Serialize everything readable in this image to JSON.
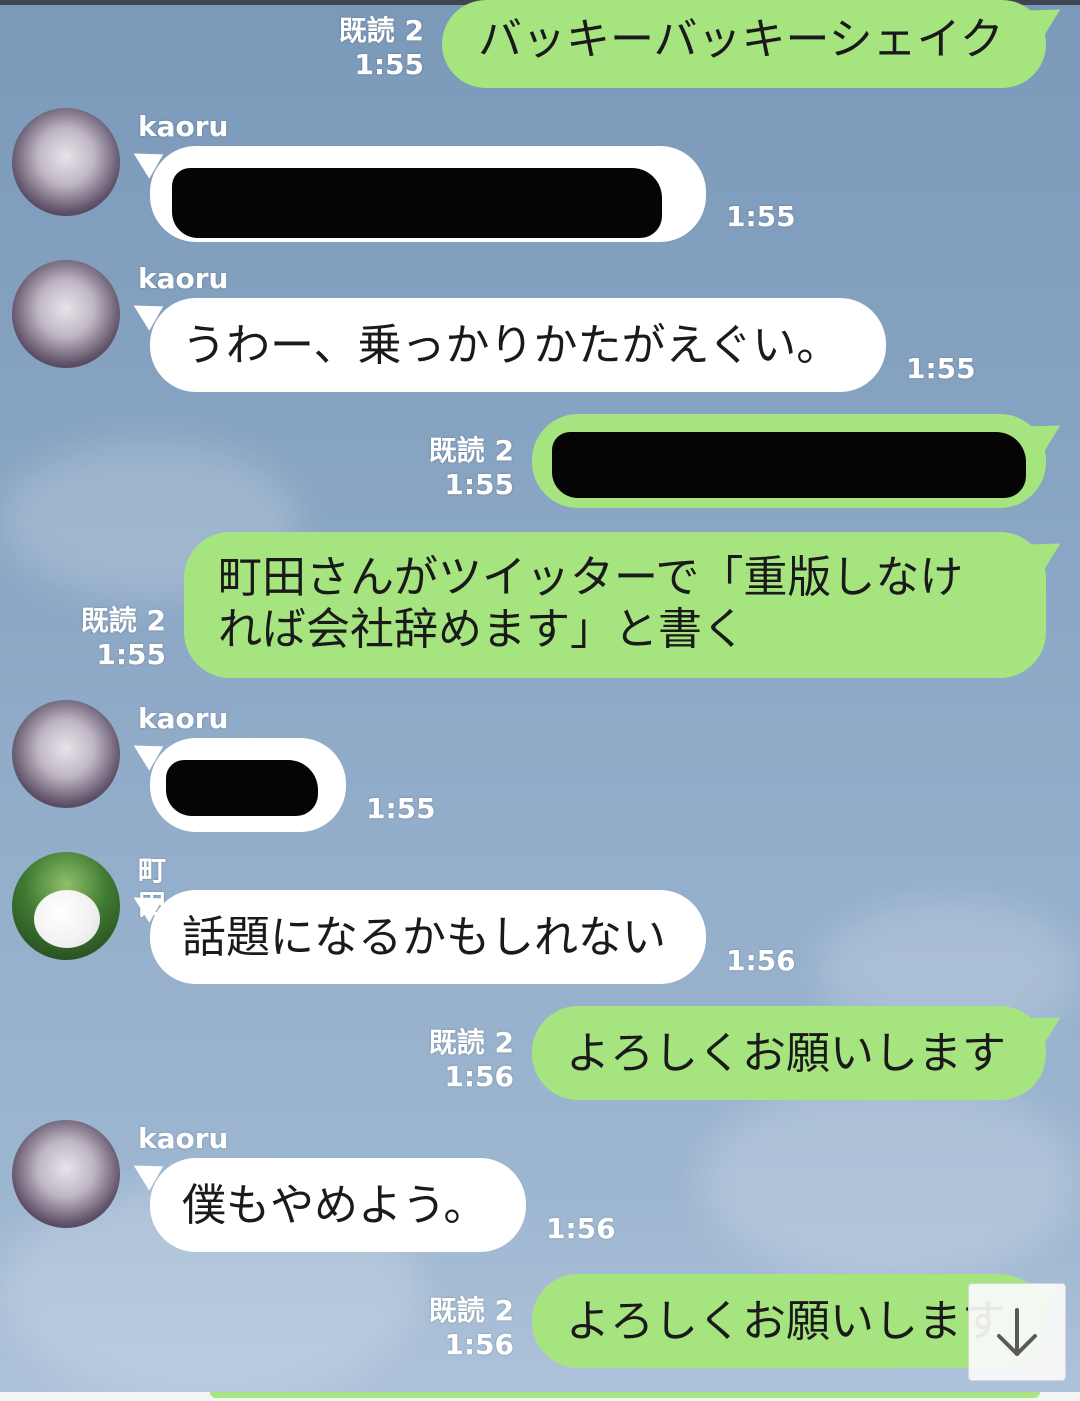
{
  "messages": [
    {
      "side": "right",
      "read": "既読 2",
      "time": "1:55",
      "text": "バッキーバッキーシェイク"
    },
    {
      "side": "left",
      "sender": "kaoru",
      "time": "1:55",
      "text": "",
      "redacted": true
    },
    {
      "side": "left",
      "sender": "kaoru",
      "time": "1:55",
      "text": "うわー、乗っかりかたがえぐい。"
    },
    {
      "side": "right",
      "read": "既読 2",
      "time": "1:55",
      "text": "",
      "redacted": true
    },
    {
      "side": "right",
      "read": "既読 2",
      "time": "1:55",
      "lines": [
        "町田さんがツイッターで「重版しなけ",
        "れば会社辞めます」と書く"
      ]
    },
    {
      "side": "left",
      "sender": "kaoru",
      "time": "1:55",
      "text": "",
      "redacted": true
    },
    {
      "side": "left",
      "sender": "町田",
      "time": "1:56",
      "text": "話題になるかもしれない"
    },
    {
      "side": "right",
      "read": "既読 2",
      "time": "1:56",
      "text": "よろしくお願いします"
    },
    {
      "side": "left",
      "sender": "kaoru",
      "time": "1:56",
      "text": "僕もやめよう。"
    },
    {
      "side": "right",
      "read": "既読 2",
      "time": "1:56",
      "text": "よろしくお願いします"
    }
  ],
  "scroll_button": {
    "icon": "arrow-down-icon"
  },
  "colors": {
    "outgoing_bubble": "#a6e480",
    "incoming_bubble": "#ffffff",
    "background": "#86a3c1"
  }
}
